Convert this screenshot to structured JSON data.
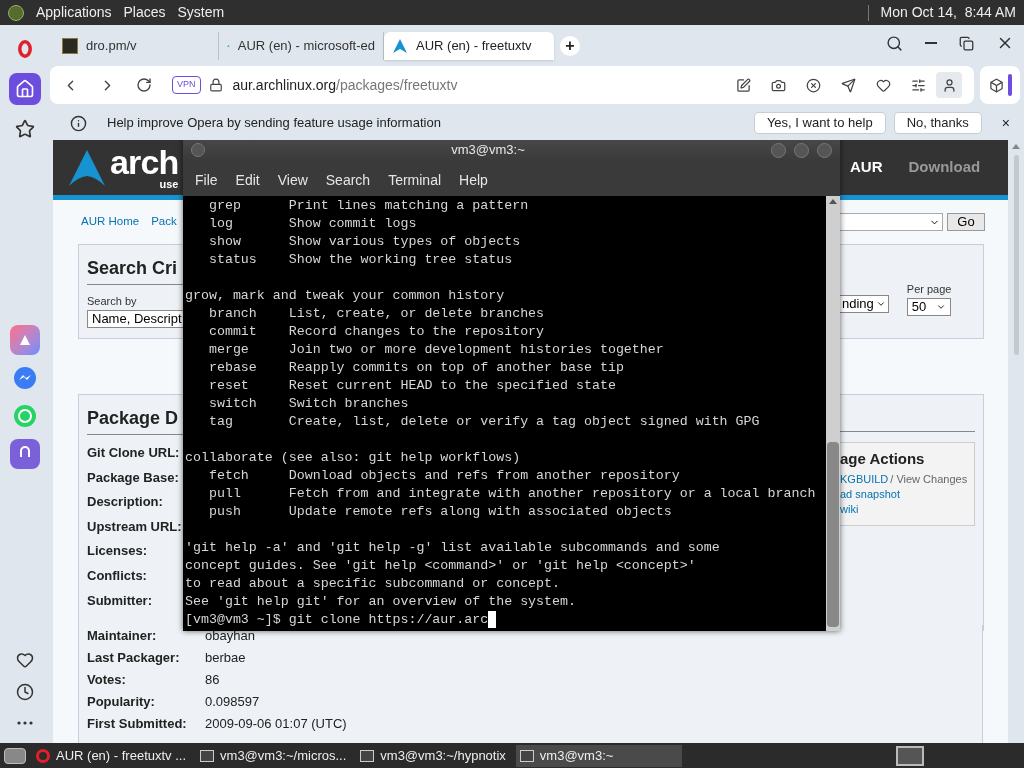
{
  "top_panel": {
    "menus": [
      "Applications",
      "Places",
      "System"
    ],
    "clock": "Mon Oct 14,  8:44 AM"
  },
  "opera_sidebar": {
    "items": [
      {
        "kind": "logo",
        "selected": false
      },
      {
        "kind": "home",
        "selected": true
      },
      {
        "kind": "star",
        "selected": false
      }
    ]
  },
  "tabs": [
    {
      "title": "dro.pm/v",
      "kind": "dark",
      "selected": false
    },
    {
      "title": "AUR (en) - microsoft-ed",
      "kind": "arch",
      "selected": false
    },
    {
      "title": "AUR (en) - freetuxtv",
      "kind": "arch",
      "selected": true
    }
  ],
  "new_tab": "+",
  "address_bar": {
    "vpn": "VPN",
    "host": "aur.archlinux.org",
    "path": "/packages/freetuxtv"
  },
  "info_bar": {
    "message": "Help improve Opera by sending feature usage information",
    "buttons": [
      "Yes, I want to help",
      "No, thanks"
    ],
    "close": "×"
  },
  "page": {
    "logo": "arch",
    "logo_sub": "use",
    "nav": [
      "AUR",
      "Download"
    ],
    "breadcrumbs": [
      "AUR Home",
      "Pack"
    ],
    "go_button": "Go",
    "search": {
      "title": "Search Cri",
      "search_by_label": "Search by",
      "search_by_value": "Name, Descript",
      "sort_value": "nding",
      "per_page_label": "Per page",
      "per_page_value": "50"
    },
    "package": {
      "title": "Package D",
      "covered_labels": [
        "Git Clone URL:",
        "Package Base:",
        "Description:",
        "Upstream URL:",
        "Licenses:",
        "Conflicts:",
        "Submitter:"
      ],
      "rows": [
        {
          "label": "Maintainer:",
          "value": "obayhan"
        },
        {
          "label": "Last Packager:",
          "value": "berbae"
        },
        {
          "label": "Votes:",
          "value": "86"
        },
        {
          "label": "Popularity:",
          "value": "0.098597"
        },
        {
          "label": "First Submitted:",
          "value": "2009-09-06 01:07 (UTC)"
        }
      ],
      "actions": {
        "title": "age Actions",
        "pkgbuild_link": "KGBUILD",
        "view_changes": "/ View Changes",
        "snapshot_link": "ad snapshot",
        "wiki_link": "wiki"
      }
    }
  },
  "terminal": {
    "title": "vm3@vm3:~",
    "menu": [
      "File",
      "Edit",
      "View",
      "Search",
      "Terminal",
      "Help"
    ],
    "blocks": [
      [
        "   grep      Print lines matching a pattern",
        "   log       Show commit logs",
        "   show      Show various types of objects",
        "   status    Show the working tree status"
      ],
      [
        "grow, mark and tweak your common history",
        "   branch    List, create, or delete branches",
        "   commit    Record changes to the repository",
        "   merge     Join two or more development histories together",
        "   rebase    Reapply commits on top of another base tip",
        "   reset     Reset current HEAD to the specified state",
        "   switch    Switch branches",
        "   tag       Create, list, delete or verify a tag object signed with GPG"
      ],
      [
        "collaborate (see also: git help workflows)",
        "   fetch     Download objects and refs from another repository",
        "   pull      Fetch from and integrate with another repository or a local branch",
        "   push      Update remote refs along with associated objects"
      ],
      [
        "'git help -a' and 'git help -g' list available subcommands and some",
        "concept guides. See 'git help <command>' or 'git help <concept>'",
        "to read about a specific subcommand or concept.",
        "See 'git help git' for an overview of the system."
      ]
    ],
    "prompt": "[vm3@vm3 ~]$ git clone https://aur.arc"
  },
  "taskbar": [
    {
      "title": "AUR (en) - freetuxtv ...",
      "kind": "browser",
      "selected": false
    },
    {
      "title": "vm3@vm3:~/micros...",
      "kind": "terminal",
      "selected": false
    },
    {
      "title": "vm3@vm3:~/hypnotix",
      "kind": "terminal",
      "selected": false
    },
    {
      "title": "vm3@vm3:~",
      "kind": "terminal",
      "selected": true
    }
  ]
}
